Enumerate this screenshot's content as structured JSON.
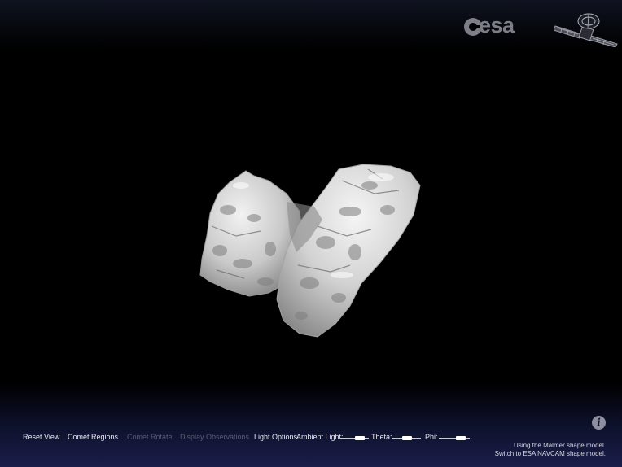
{
  "branding": {
    "logo_text": "esa",
    "logo_icon": "esa-logo-mark",
    "spacecraft_icon": "rosetta-spacecraft-icon"
  },
  "viewer": {
    "object": "comet-3d-shape-model",
    "background": "#000000"
  },
  "toolbar": {
    "reset_view": "Reset View",
    "comet_regions": "Comet Regions",
    "comet_rotate": "Comet Rotate",
    "display_observations": "Display Observations",
    "light_options": "Light Options",
    "ambient_light_label": "Ambient Light:",
    "ambient_light_value": 0.8,
    "theta_label": "Theta:",
    "theta_value": 0.55,
    "phi_label": "Phi:",
    "phi_value": 0.8
  },
  "info": {
    "icon": "info-icon",
    "symbol": "i"
  },
  "model_note": {
    "current": "Using the Malmer shape model.",
    "switch": "Switch to ESA NAVCAM shape model."
  },
  "colors": {
    "toolbar_bg": "#1a1e4a",
    "text": "#e8e8ee",
    "disabled_text": "#5a5c72",
    "logo_gray": "#7d7f88"
  }
}
